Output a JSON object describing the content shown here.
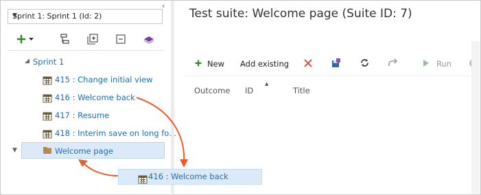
{
  "colors": {
    "accent": "#1a6fb5",
    "arrow": "#f05a28",
    "selection": "#dbe9f8",
    "folder": "#b58a4a",
    "add_green": "#2a8a2a",
    "delete_red": "#d9534f"
  },
  "left_pane": {
    "collapse_glyph": "‹",
    "plan_select": {
      "value": "Sprint 1: Sprint 1 (Id: 2)"
    },
    "toolbar": [
      {
        "icon": "add-icon",
        "has_dropdown": true
      },
      {
        "icon": "tree-hierarchy-icon"
      },
      {
        "icon": "expand-all-icon"
      },
      {
        "icon": "collapse-all-icon"
      },
      {
        "icon": "work-item-icon"
      }
    ],
    "tree": {
      "root": {
        "label": "Sprint 1",
        "expanded": true
      },
      "items": [
        {
          "label": "415 : Change initial view",
          "type": "requirement-suite"
        },
        {
          "label": "416 : Welcome back",
          "type": "requirement-suite"
        },
        {
          "label": "417 : Resume",
          "type": "requirement-suite"
        },
        {
          "label": "418 : Interim save on long fo...",
          "type": "requirement-suite"
        },
        {
          "label": "Welcome page",
          "type": "static-suite",
          "selected": true
        }
      ]
    },
    "drag_ghost": {
      "label": "416 : Welcome back"
    }
  },
  "right_pane": {
    "title": "Test suite: Welcome page (Suite ID: 7)",
    "toolbar": {
      "new_label": "New",
      "add_existing_label": "Add existing",
      "run_label": "Run"
    },
    "columns": [
      "Outcome",
      "ID",
      "Title"
    ],
    "sort_column": "ID"
  }
}
